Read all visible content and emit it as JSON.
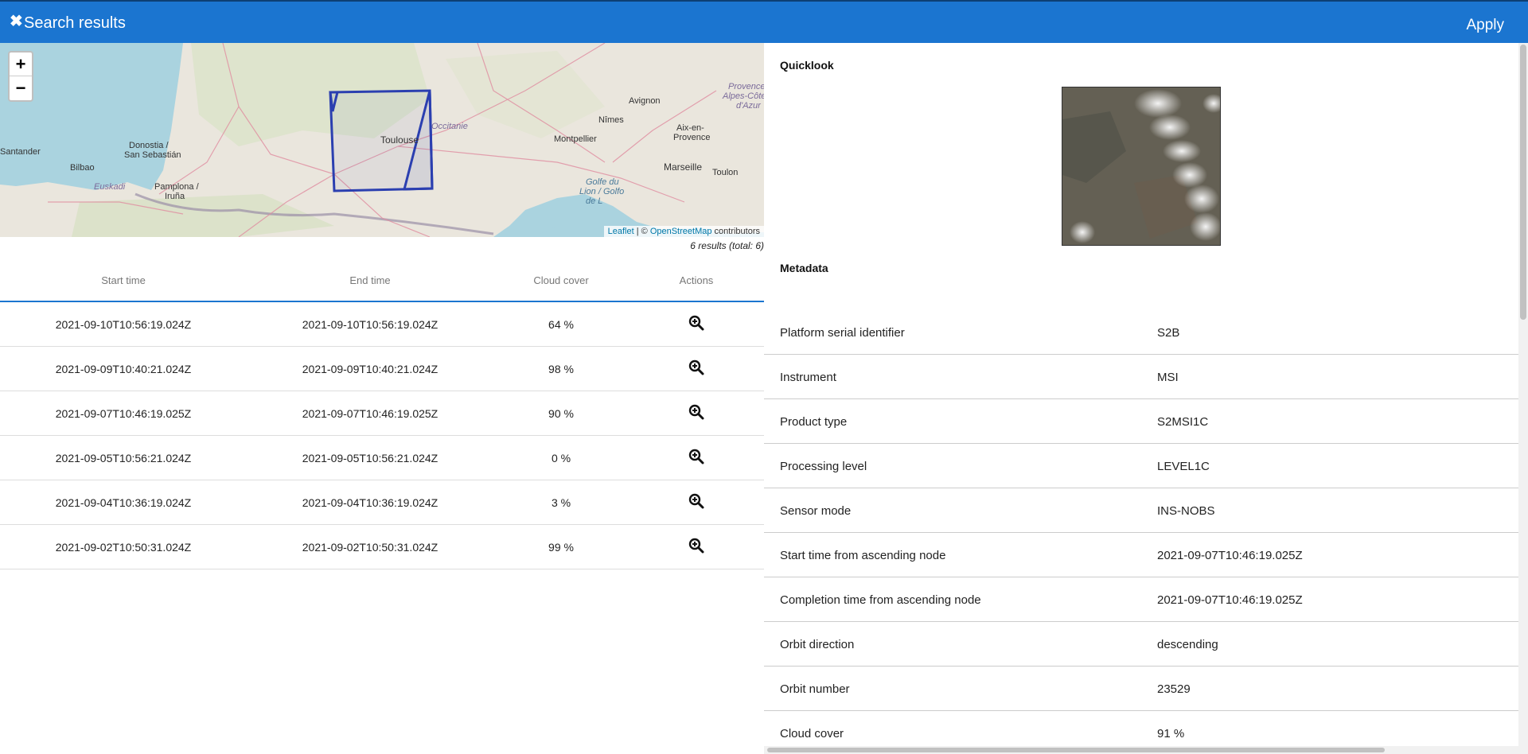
{
  "header": {
    "close_glyph": "✖",
    "title": "Search results",
    "apply_label": "Apply"
  },
  "map": {
    "zoom_in": "+",
    "zoom_out": "−",
    "labels": {
      "santander": "Santander",
      "donostia": "Donostia /",
      "san_sebastian": "San Sebastián",
      "bilbao": "Bilbao",
      "euskadi": "Euskadi",
      "pamplona": "Pamplona /",
      "iruna": "Iruña",
      "toulouse": "Toulouse",
      "occitanie": "Occitanie",
      "nimes": "Nîmes",
      "avignon": "Avignon",
      "montpellier": "Montpellier",
      "aix": "Aix-en-",
      "provence": "Provence",
      "marseille": "Marseille",
      "toulon": "Toulon",
      "region1": "Provence-",
      "region2": "Alpes-Côte",
      "region3": "d'Azur",
      "golfe1": "Golfe du",
      "golfe2": "Lion / Golfo",
      "golfe3": "de L"
    },
    "attribution": {
      "leaflet": "Leaflet",
      "sep": " | © ",
      "osm": "OpenStreetMap",
      "contrib": " contributors"
    }
  },
  "results": {
    "count_text": "6 results (total: 6)",
    "columns": {
      "start": "Start time",
      "end": "End time",
      "cloud": "Cloud cover",
      "actions": "Actions"
    },
    "rows": [
      {
        "start": "2021-09-10T10:56:19.024Z",
        "end": "2021-09-10T10:56:19.024Z",
        "cloud": "64 %"
      },
      {
        "start": "2021-09-09T10:40:21.024Z",
        "end": "2021-09-09T10:40:21.024Z",
        "cloud": "98 %"
      },
      {
        "start": "2021-09-07T10:46:19.025Z",
        "end": "2021-09-07T10:46:19.025Z",
        "cloud": "90 %"
      },
      {
        "start": "2021-09-05T10:56:21.024Z",
        "end": "2021-09-05T10:56:21.024Z",
        "cloud": "0 %"
      },
      {
        "start": "2021-09-04T10:36:19.024Z",
        "end": "2021-09-04T10:36:19.024Z",
        "cloud": "3 %"
      },
      {
        "start": "2021-09-02T10:50:31.024Z",
        "end": "2021-09-02T10:50:31.024Z",
        "cloud": "99 %"
      }
    ],
    "action_icon": "zoom-in-icon"
  },
  "details": {
    "quicklook_title": "Quicklook",
    "metadata_title": "Metadata",
    "metadata": [
      {
        "key": "Platform serial identifier",
        "value": "S2B"
      },
      {
        "key": "Instrument",
        "value": "MSI"
      },
      {
        "key": "Product type",
        "value": "S2MSI1C"
      },
      {
        "key": "Processing level",
        "value": "LEVEL1C"
      },
      {
        "key": "Sensor mode",
        "value": "INS-NOBS"
      },
      {
        "key": "Start time from ascending node",
        "value": "2021-09-07T10:46:19.025Z"
      },
      {
        "key": "Completion time from ascending node",
        "value": "2021-09-07T10:46:19.025Z"
      },
      {
        "key": "Orbit direction",
        "value": "descending"
      },
      {
        "key": "Orbit number",
        "value": "23529"
      },
      {
        "key": "Cloud cover",
        "value": "91 %"
      }
    ]
  },
  "colors": {
    "header": "#1b75d0",
    "footprint": "#2b3fb0",
    "sea": "#aad3df",
    "land": "#eae6dd"
  }
}
